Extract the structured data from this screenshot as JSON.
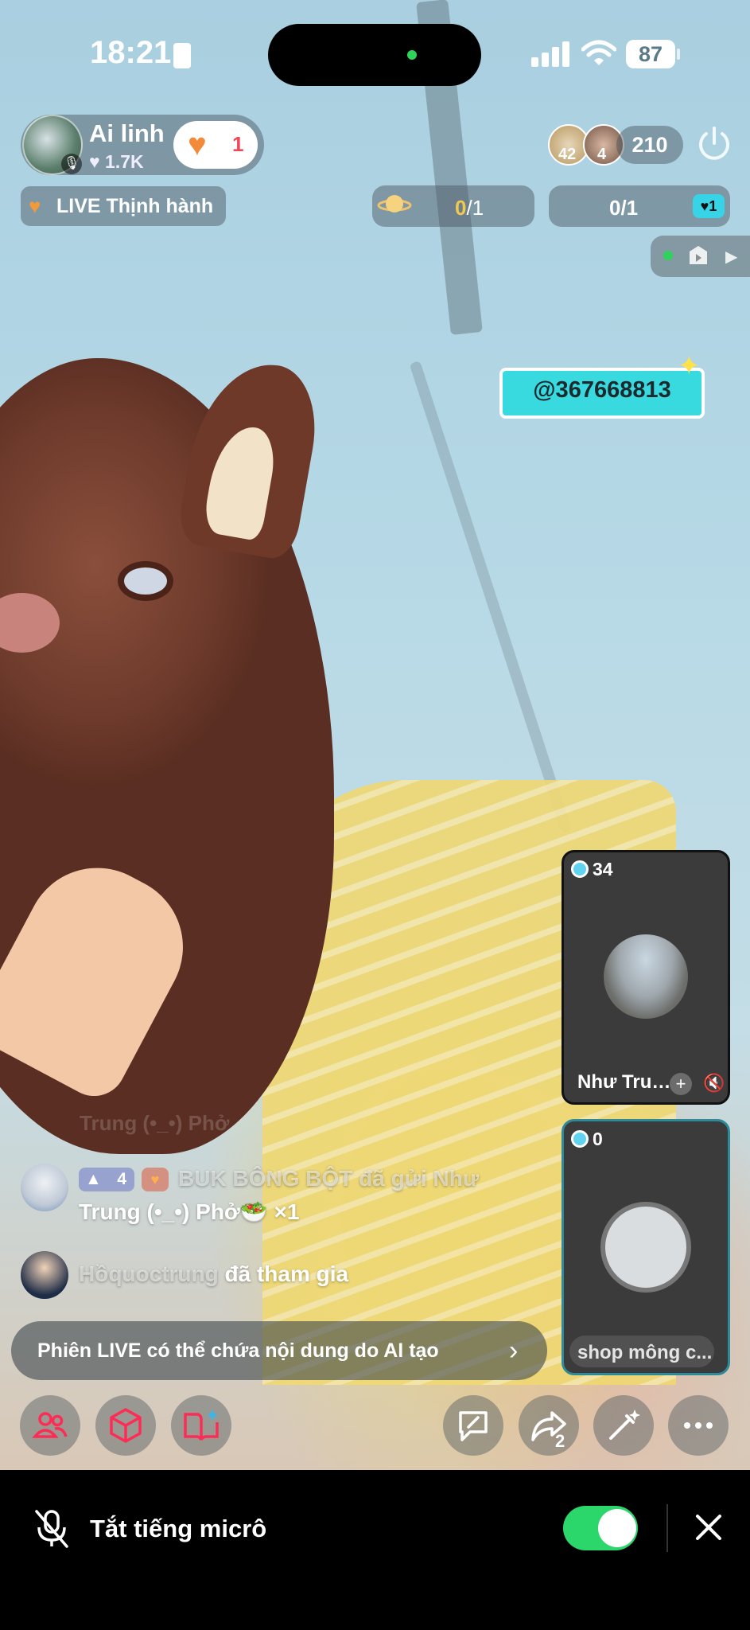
{
  "status_bar": {
    "time": "18:21",
    "battery": "87"
  },
  "host": {
    "name": "Ai linh",
    "likes": "1.7K",
    "follow_count": "1"
  },
  "trending": {
    "label": "LIVE Thịnh hành"
  },
  "viewers": {
    "rank_1": "42",
    "rank_2": "4",
    "count": "210"
  },
  "goals": [
    {
      "current": "0",
      "total": "/1",
      "icon": "planet-icon"
    },
    {
      "text": "0/1",
      "badge": "1",
      "icon": "heart-badge-icon"
    }
  ],
  "sticker": {
    "text": "@367668813"
  },
  "guests": [
    {
      "score": "34",
      "name": "Như Tru…"
    },
    {
      "score": "0",
      "name": "shop mông c..."
    }
  ],
  "chat": {
    "faded": "Trung (•_•) Phở",
    "messages": [
      {
        "rank": "4",
        "name": "BUK BÔNG BỘT",
        "text_a": "đã gửi Như",
        "text_b": "Trung (•_•) Phở🥗 ×1"
      },
      {
        "name": "Hồquoctrung",
        "text": "đã tham gia"
      }
    ]
  },
  "ai_notice": {
    "text": "Phiên LIVE có thể chứa nội dung do AI tạo"
  },
  "actions": {
    "share_count": "2"
  },
  "mic_sheet": {
    "label": "Tắt tiếng micrô",
    "toggle_on": true
  },
  "colors": {
    "accent_pink": "#fe2c55",
    "toggle_green": "#2bd66a",
    "sticker_cyan": "#39d9e0"
  }
}
